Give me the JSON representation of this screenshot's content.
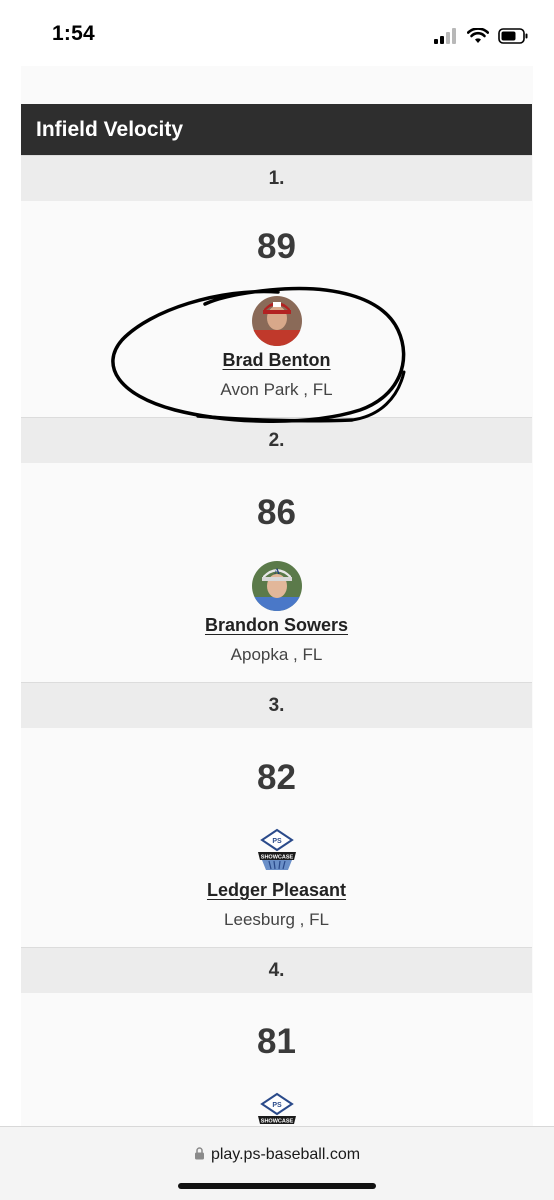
{
  "status_bar": {
    "time": "1:54",
    "icons": [
      "cellular-signal-icon",
      "wifi-icon",
      "battery-icon"
    ]
  },
  "section": {
    "title": "Infield Velocity"
  },
  "entries": [
    {
      "rank": "1.",
      "velocity": "89",
      "name": "Brad Benton",
      "location": "Avon Park , FL",
      "image": "player-photo",
      "circled": true
    },
    {
      "rank": "2.",
      "velocity": "86",
      "name": "Brandon Sowers",
      "location": "Apopka , FL",
      "image": "player-photo"
    },
    {
      "rank": "3.",
      "velocity": "82",
      "name": "Ledger Pleasant",
      "location": "Leesburg , FL",
      "image": "ps-showcase-logo"
    },
    {
      "rank": "4.",
      "velocity": "81",
      "name": "",
      "location": "",
      "image": "ps-showcase-logo"
    }
  ],
  "browser": {
    "url": "play.ps-baseball.com",
    "lock_icon": "lock-icon"
  },
  "colors": {
    "header_bg": "#2e2e2e",
    "rank_row_bg": "#ececec",
    "entry_bg": "#fafafa",
    "annotation_ink": "#000000"
  }
}
